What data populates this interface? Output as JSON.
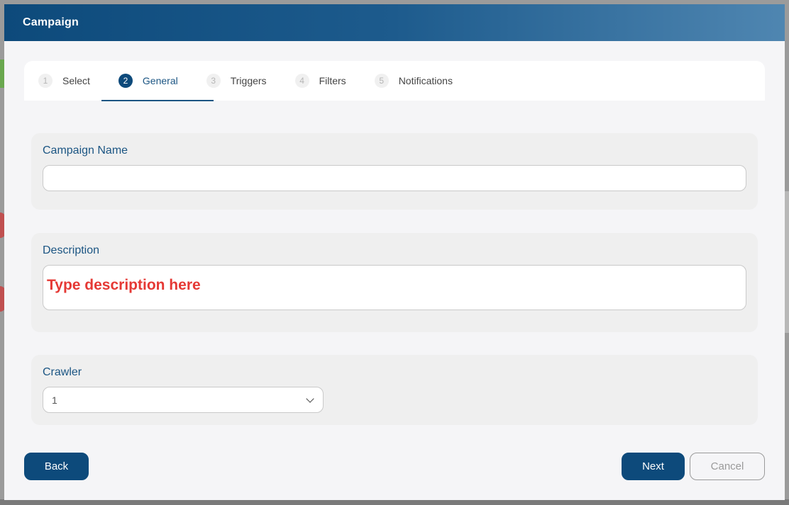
{
  "modal": {
    "title": "Campaign"
  },
  "stepper": {
    "steps": [
      {
        "number": "1",
        "label": "Select",
        "active": false
      },
      {
        "number": "2",
        "label": "General",
        "active": true
      },
      {
        "number": "3",
        "label": "Triggers",
        "active": false
      },
      {
        "number": "4",
        "label": "Filters",
        "active": false
      },
      {
        "number": "5",
        "label": "Notifications",
        "active": false
      }
    ]
  },
  "form": {
    "campaign_name": {
      "label": "Campaign Name",
      "value": ""
    },
    "description": {
      "label": "Description",
      "value": "",
      "hint": "Type description here"
    },
    "crawler": {
      "label": "Crawler",
      "selected": "1"
    }
  },
  "actions": {
    "back_label": "Back",
    "next_label": "Next",
    "cancel_label": "Cancel"
  },
  "colors": {
    "primary": "#0d4a7b",
    "label": "#1b5583",
    "hint": "#e53935"
  }
}
